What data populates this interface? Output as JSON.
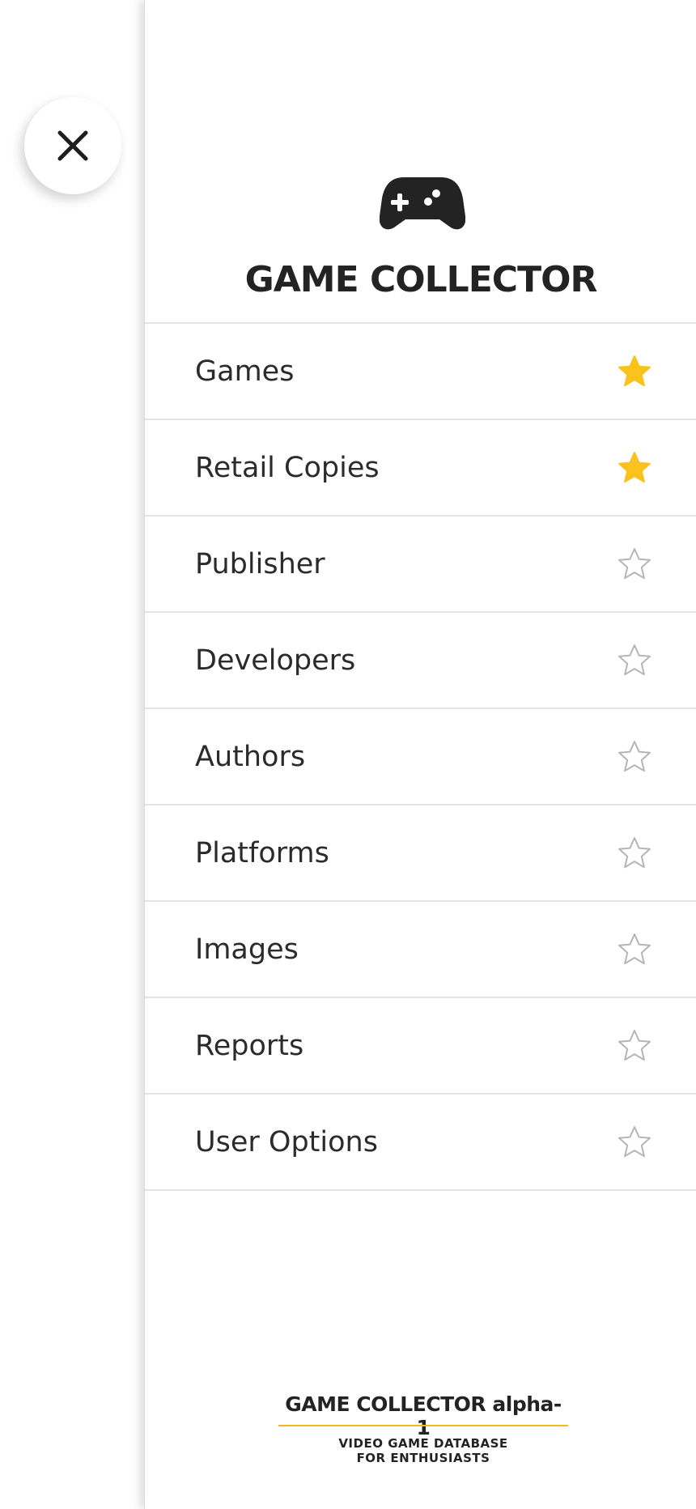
{
  "close": {
    "icon": "close-icon"
  },
  "brand": {
    "logo_icon": "gamepad-icon",
    "title": "GAME COLLECTOR"
  },
  "colors": {
    "accent": "#F5B91A",
    "star_filled": "#F9C21C",
    "star_outline": "#B5B5B5",
    "text": "#2B2B2B"
  },
  "menu": {
    "items": [
      {
        "label": "Games",
        "favorite": true
      },
      {
        "label": "Retail Copies",
        "favorite": true
      },
      {
        "label": "Publisher",
        "favorite": false
      },
      {
        "label": "Developers",
        "favorite": false
      },
      {
        "label": "Authors",
        "favorite": false
      },
      {
        "label": "Platforms",
        "favorite": false
      },
      {
        "label": "Images",
        "favorite": false
      },
      {
        "label": "Reports",
        "favorite": false
      },
      {
        "label": "User Options",
        "favorite": false
      }
    ]
  },
  "footer": {
    "title": "GAME COLLECTOR alpha-1",
    "subtitle": "VIDEO GAME DATABASE\nFOR ENTHUSIASTS"
  }
}
